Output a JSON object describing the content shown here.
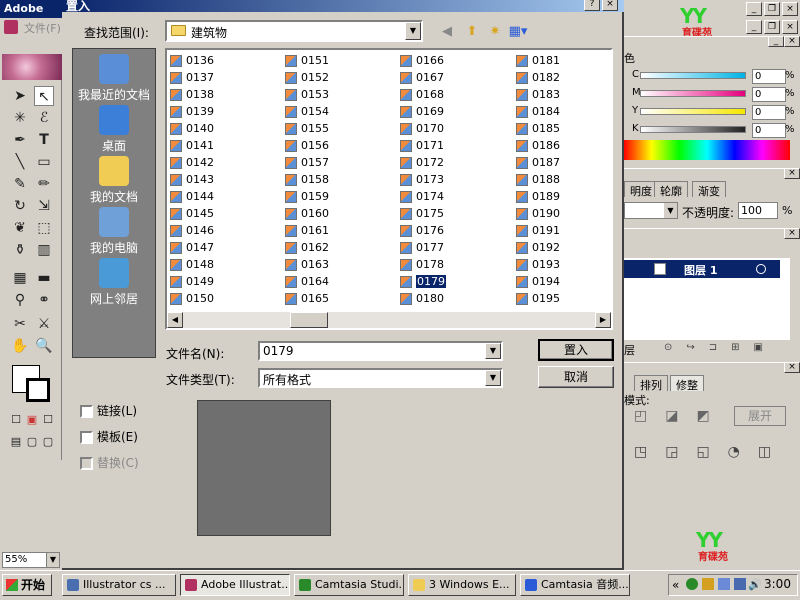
{
  "illustrator": {
    "title": "Adobe",
    "menu_file": "文件(F)",
    "zoom": "55%",
    "window_buttons": [
      "_",
      "❐",
      "×"
    ],
    "color_panel": {
      "channels": [
        {
          "label": "C",
          "value": "0",
          "unit": "%",
          "color": "#00b3e6"
        },
        {
          "label": "M",
          "value": "0",
          "unit": "%",
          "color": "#e6007e"
        },
        {
          "label": "Y",
          "value": "0",
          "unit": "%",
          "color": "#f5e600"
        },
        {
          "label": "K",
          "value": "0",
          "unit": "%",
          "color": "#222222"
        }
      ],
      "tab_fragment": "色"
    },
    "transparency_tabs": [
      "明度",
      "轮廓",
      "渐变"
    ],
    "opacity_label": "不透明度:",
    "opacity_value": "100",
    "opacity_unit": "%",
    "layers": {
      "layer_name": "图层 1",
      "tab_fragment": "层"
    },
    "align_tabs": [
      "排列",
      "修整"
    ],
    "shape_mode_fragment": "模式:",
    "expand_label": "展开",
    "logo_text": "YY",
    "logo_sub": "育碟苑"
  },
  "dialog": {
    "title": "置入",
    "help": "?",
    "close": "×",
    "look_in_label": "查找范围(I):",
    "look_in_value": "建筑物",
    "places": [
      {
        "label": "我最近的文档",
        "icon": "recent-docs-icon",
        "color": "#5a8fd8"
      },
      {
        "label": "桌面",
        "icon": "desktop-icon",
        "color": "#3c7fd8"
      },
      {
        "label": "我的文档",
        "icon": "my-documents-icon",
        "color": "#f0cc55"
      },
      {
        "label": "我的电脑",
        "icon": "my-computer-icon",
        "color": "#6fa0d8"
      },
      {
        "label": "网上邻居",
        "icon": "network-places-icon",
        "color": "#4a9ad8"
      }
    ],
    "files": [
      [
        "0136",
        "0137",
        "0138",
        "0139",
        "0140",
        "0141",
        "0142",
        "0143",
        "0144",
        "0145",
        "0146",
        "0147",
        "0148",
        "0149",
        "0150"
      ],
      [
        "0151",
        "0152",
        "0153",
        "0154",
        "0155",
        "0156",
        "0157",
        "0158",
        "0159",
        "0160",
        "0161",
        "0162",
        "0163",
        "0164",
        "0165"
      ],
      [
        "0166",
        "0167",
        "0168",
        "0169",
        "0170",
        "0171",
        "0172",
        "0173",
        "0174",
        "0175",
        "0176",
        "0177",
        "0178",
        "0179",
        "0180"
      ],
      [
        "0181",
        "0182",
        "0183",
        "0184",
        "0185",
        "0186",
        "0187",
        "0188",
        "0189",
        "0190",
        "0191",
        "0192",
        "0193",
        "0194",
        "0195"
      ]
    ],
    "selected_file": "0179",
    "filename_label": "文件名(N):",
    "filename_value": "0179",
    "filetype_label": "文件类型(T):",
    "filetype_value": "所有格式",
    "place_button": "置入",
    "cancel_button": "取消",
    "checkboxes": [
      {
        "label": "链接(L)",
        "enabled": true
      },
      {
        "label": "模板(E)",
        "enabled": true
      },
      {
        "label": "替换(C)",
        "enabled": false
      }
    ]
  },
  "taskbar": {
    "start": "开始",
    "tasks": [
      {
        "label": "Illustrator cs ...",
        "color": "#4a6fb0",
        "active": false
      },
      {
        "label": "Adobe Illustrat...",
        "color": "#b03060",
        "active": true
      },
      {
        "label": "Camtasia Studi...",
        "color": "#2a8a2a",
        "active": false
      },
      {
        "label": "3 Windows E...",
        "color": "#f0cc55",
        "active": false
      },
      {
        "label": "Camtasia 音频...",
        "color": "#2a5ad8",
        "active": false
      }
    ],
    "tray_chevron": "«",
    "clock": "3:00"
  }
}
